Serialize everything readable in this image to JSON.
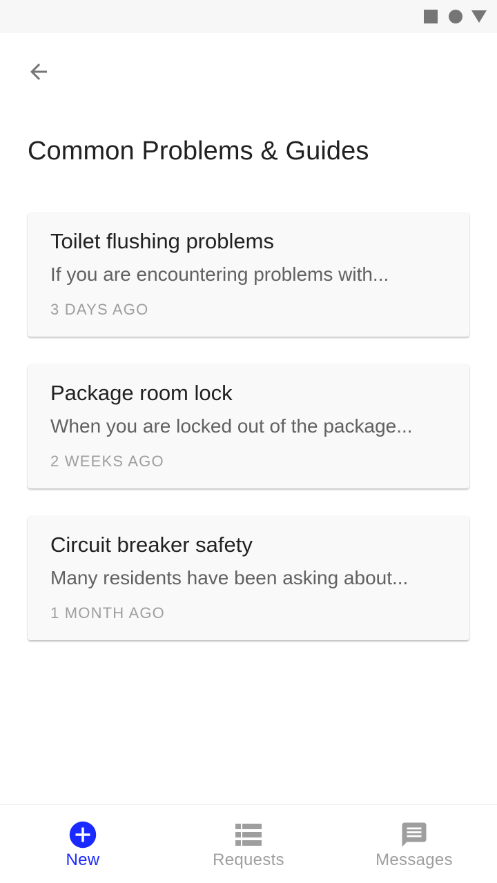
{
  "colors": {
    "accent": "#1a29ff",
    "status_icon": "#757575",
    "inactive": "#9e9e9e",
    "card_bg": "#f9f9f9"
  },
  "status_bar": {
    "icons": [
      "square-icon",
      "circle-icon",
      "triangle-icon"
    ]
  },
  "header": {
    "back_icon": "arrow-left-icon",
    "title": "Common Problems & Guides"
  },
  "cards": [
    {
      "title": "Toilet flushing problems",
      "excerpt": "If you are encountering problems with...",
      "time": "3 DAYS AGO"
    },
    {
      "title": "Package room lock",
      "excerpt": "When you are locked out of the package...",
      "time": "2 WEEKS AGO"
    },
    {
      "title": "Circuit breaker safety",
      "excerpt": "Many residents have been asking about...",
      "time": "1 MONTH AGO"
    }
  ],
  "bottom_nav": {
    "items": [
      {
        "label": "New",
        "icon": "add-circle-icon",
        "active": true
      },
      {
        "label": "Requests",
        "icon": "list-icon",
        "active": false
      },
      {
        "label": "Messages",
        "icon": "chat-icon",
        "active": false
      }
    ]
  }
}
